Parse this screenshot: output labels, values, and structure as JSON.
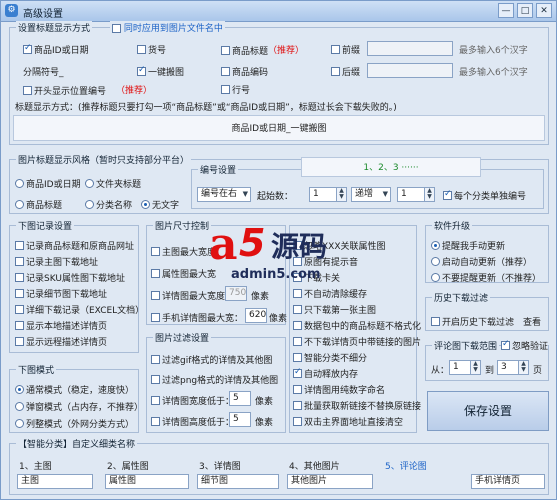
{
  "window": {
    "title": "高级设置"
  },
  "title_display": {
    "legend": "设置标题显示方式",
    "sync_label": "同时应用到图片文件名中",
    "cols": [
      {
        "label": "商品ID或日期",
        "checked": true
      },
      {
        "label": "货号",
        "checked": false
      },
      {
        "label": "商品标题",
        "checked": false,
        "note": "（推荐）"
      },
      {
        "label": "前缀",
        "checked": false
      }
    ],
    "hint1": "最多输入6个汉字",
    "separator_label": "分隔符号_",
    "row2": [
      {
        "label": "一键搬图",
        "checked": true
      },
      {
        "label": "商品编码",
        "checked": false
      },
      {
        "label": "后缀",
        "checked": false
      }
    ],
    "hint2": "最多输入6个汉字",
    "row3": [
      {
        "label": "开头显示位置编号",
        "checked": false,
        "note": "（推荐）"
      },
      {
        "label": "行号",
        "checked": false
      }
    ],
    "desc": "标题显示方式：(推荐标题只要打勾一项“商品标题”或“商品ID或日期”，标题过长会下载失败的。)",
    "preview": "商品ID或日期_一键搬图"
  },
  "image_style": {
    "legend": "图片标题显示风格（暂时只支持部分平台）",
    "options_r1": [
      {
        "label": "商品ID或日期",
        "on": false
      },
      {
        "label": "文件夹标题",
        "on": false
      }
    ],
    "options_r2": [
      {
        "label": "商品标题",
        "on": false
      },
      {
        "label": "分类名称",
        "on": false
      },
      {
        "label": "无文字",
        "on": true
      }
    ],
    "numbering_legend": "编号设置",
    "numbering_preview": "1、2、3 ······",
    "position": "编号在右",
    "start_label": "起始数：",
    "start_value": "1",
    "order": "递增",
    "step": "1",
    "per_category_label": "每个分类单独编号",
    "per_category_checked": true
  },
  "download_record": {
    "legend": "下图记录设置",
    "items": [
      "记录商品标题和原商品网址",
      "记录主图下载地址",
      "记录SKU属性图下载地址",
      "记录细节图下载地址",
      "详细下载记录（EXCEL文档）",
      "显示本地描述详情页",
      "显示远程描述详情页"
    ]
  },
  "image_size": {
    "legend": "图片尺寸控制",
    "rows": [
      {
        "label": "主图最大宽度",
        "value": ""
      },
      {
        "label": "属性图最大宽",
        "value": ""
      },
      {
        "label": "详情图最大宽度：",
        "value": "750",
        "unit": "像素"
      },
      {
        "label": "手机详情图最大宽：",
        "value": "620",
        "unit": "像素"
      }
    ]
  },
  "image_filter": {
    "legend": "图片过滤设置",
    "items": [
      "过滤gif格式的详情及其他图",
      "过滤png格式的详情及其他图"
    ],
    "width_label": "详情图宽度低于：",
    "width_value": "5",
    "height_label": "详情图高度低于：",
    "height_value": "5",
    "unit": "像素"
  },
  "misc_options": [
    {
      "label": "忽略XXX关联属性图",
      "checked": false
    },
    {
      "label": "原图有提示音",
      "checked": false
    },
    {
      "label": "下载卡关",
      "checked": false
    },
    {
      "label": "不自动清除缓存",
      "checked": false
    },
    {
      "label": "只下载第一张主图",
      "checked": false
    },
    {
      "label": "数据包中的商品标题不格式化",
      "checked": false
    },
    {
      "label": "不下载详情页中带链接的图片",
      "checked": false
    },
    {
      "label": "智能分类不细分",
      "checked": false
    },
    {
      "label": "自动释放内存",
      "checked": true
    },
    {
      "label": "详情图用纯数字命名",
      "checked": false
    },
    {
      "label": "批量获取新链接不替换原链接",
      "checked": false
    },
    {
      "label": "双击主界面地址直接清空",
      "checked": false
    }
  ],
  "upgrade": {
    "legend": "软件升级",
    "options": [
      {
        "label": "提醒我手动更新",
        "on": true
      },
      {
        "label": "启动自动更新（推荐）",
        "on": false
      },
      {
        "label": "不要提醒更新（不推荐）",
        "on": false
      }
    ]
  },
  "history": {
    "legend": "历史下载过滤",
    "enable_label": "开启历史下载过滤",
    "view_label": "查看"
  },
  "comments": {
    "legend": "评论图下载范围",
    "skip_label": "忽略验证",
    "from_label": "从：",
    "from_value": "1",
    "to_label": "到",
    "to_value": "3",
    "page_label": "页"
  },
  "download_mode": {
    "legend": "下图模式",
    "options": [
      {
        "label": "通常模式（稳定，速度快）",
        "on": true
      },
      {
        "label": "弹窗模式（占内存，不推荐）",
        "on": false
      },
      {
        "label": "列整模式（外网分类方式）",
        "on": false
      }
    ]
  },
  "save_button": "保存设置",
  "smart_category": {
    "legend": "【智能分类】自定义细类名称",
    "labels": [
      "1、主图",
      "2、属性图",
      "3、详情图",
      "4、其他图片",
      "5、评论图"
    ],
    "values": [
      "主图",
      "属性图",
      "细节图",
      "其他图片",
      "手机详情页"
    ]
  },
  "watermark": {
    "brand_a": "a",
    "brand_5": "5",
    "brand_text": "源码",
    "url": "admin5.com"
  },
  "colors": {
    "accent": "#1d63c7",
    "red": "#e01010",
    "save_bg": "#c9d8ee"
  }
}
